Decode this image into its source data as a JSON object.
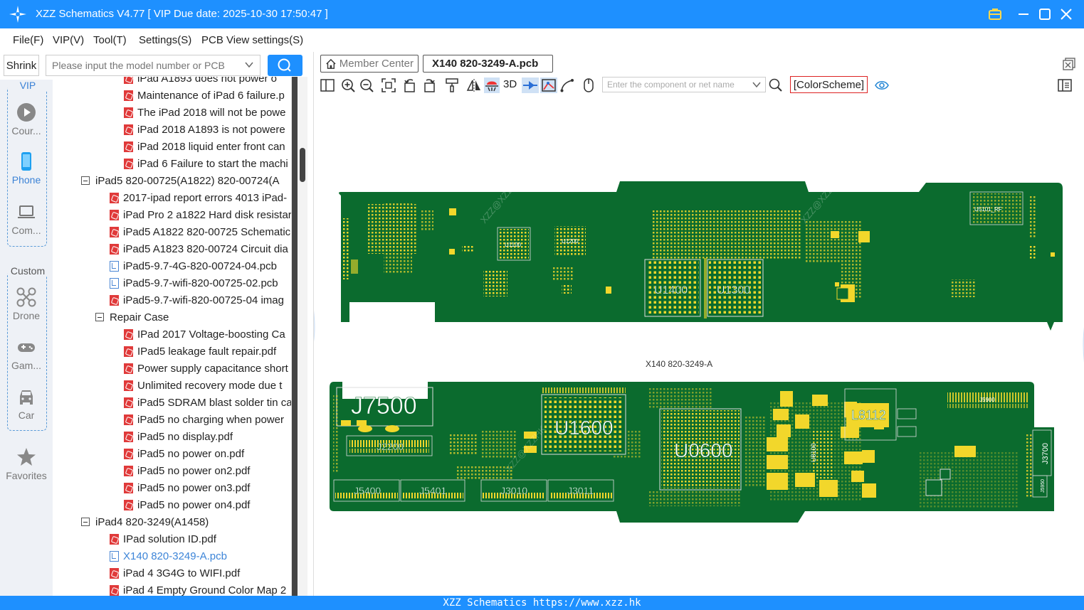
{
  "window": {
    "title": "XZZ Schematics V4.77 [ VIP Due date: 2025-10-30 17:50:47 ]"
  },
  "menu": [
    "File(F)",
    "VIP(V)",
    "Tool(T)",
    "Settings(S)",
    "PCB View settings(S)"
  ],
  "left_toolbar": {
    "shrink_label": "Shrink",
    "search_placeholder": "Please input the model number or PCB"
  },
  "rail": {
    "vip_group_label": "VIP",
    "custom_group_label": "Custom",
    "items": [
      {
        "label": "Cour...",
        "icon": "play-icon"
      },
      {
        "label": "Phone",
        "icon": "phone-icon"
      },
      {
        "label": "Com...",
        "icon": "laptop-icon"
      },
      {
        "label": "Drone",
        "icon": "drone-icon"
      },
      {
        "label": "Gam...",
        "icon": "gamepad-icon"
      },
      {
        "label": "Car",
        "icon": "car-icon"
      },
      {
        "label": "Favorites",
        "icon": "star-icon"
      }
    ]
  },
  "tree": [
    {
      "type": "pdf",
      "indent": 2,
      "label": "iPad A1893 does not power o"
    },
    {
      "type": "pdf",
      "indent": 2,
      "label": "Maintenance of iPad 6 failure.p"
    },
    {
      "type": "pdf",
      "indent": 2,
      "label": "The iPad 2018 will not be powe"
    },
    {
      "type": "pdf",
      "indent": 2,
      "label": "iPad 2018 A1893 is not powere"
    },
    {
      "type": "pdf",
      "indent": 2,
      "label": "iPad 2018 liquid enter front can"
    },
    {
      "type": "pdf",
      "indent": 2,
      "label": "iPad 6 Failure to start the machi"
    },
    {
      "type": "folder",
      "indent": 0,
      "label": "iPad5 820-00725(A1822) 820-00724(A"
    },
    {
      "type": "pdf",
      "indent": 1,
      "label": "2017-ipad report errors 4013 iPad-"
    },
    {
      "type": "pdf",
      "indent": 1,
      "label": "iPad Pro 2 a1822 Hard disk resistar"
    },
    {
      "type": "pdf",
      "indent": 1,
      "label": "iPad5 A1822 820-00725 Schematic"
    },
    {
      "type": "pdf",
      "indent": 1,
      "label": "iPad5 A1823 820-00724 Circuit dia"
    },
    {
      "type": "pcb",
      "indent": 1,
      "label": "iPad5-9.7-4G-820-00724-04.pcb"
    },
    {
      "type": "pcb",
      "indent": 1,
      "label": "iPad5-9.7-wifi-820-00725-02.pcb"
    },
    {
      "type": "pdf",
      "indent": 1,
      "label": "iPad5-9.7-wifi-820-00725-04 imag"
    },
    {
      "type": "folder",
      "indent": 1,
      "label": "Repair Case"
    },
    {
      "type": "pdf",
      "indent": 2,
      "label": "IPad 2017 Voltage-boosting Ca"
    },
    {
      "type": "pdf",
      "indent": 2,
      "label": "IPad5 leakage fault repair.pdf"
    },
    {
      "type": "pdf",
      "indent": 2,
      "label": "Power supply capacitance short"
    },
    {
      "type": "pdf",
      "indent": 2,
      "label": "Unlimited recovery mode due t"
    },
    {
      "type": "pdf",
      "indent": 2,
      "label": "iPad5 SDRAM blast solder tin ca"
    },
    {
      "type": "pdf",
      "indent": 2,
      "label": "iPad5 no charging when power"
    },
    {
      "type": "pdf",
      "indent": 2,
      "label": "iPad5 no display.pdf"
    },
    {
      "type": "pdf",
      "indent": 2,
      "label": "iPad5 no power on.pdf"
    },
    {
      "type": "pdf",
      "indent": 2,
      "label": "iPad5 no power on2.pdf"
    },
    {
      "type": "pdf",
      "indent": 2,
      "label": "iPad5 no power on3.pdf"
    },
    {
      "type": "pdf",
      "indent": 2,
      "label": "iPad5 no power on4.pdf"
    },
    {
      "type": "folder",
      "indent": 0,
      "label": "iPad4 820-3249(A1458)"
    },
    {
      "type": "pdf",
      "indent": 1,
      "label": "IPad solution ID.pdf"
    },
    {
      "type": "pcb",
      "indent": 1,
      "label": "X140 820-3249-A.pcb",
      "selected": true
    },
    {
      "type": "pdf",
      "indent": 1,
      "label": "iPad 4 3G4G to WIFI.pdf"
    },
    {
      "type": "pdf",
      "indent": 1,
      "label": "iPad 4 Empty Ground Color Map 2"
    }
  ],
  "tabs": {
    "member": "Member Center",
    "pcb": "X140 820-3249-A.pcb"
  },
  "pcb_toolbar": {
    "label_3d": "3D",
    "component_placeholder": "Enter the component or net name",
    "color_scheme": "[ColorScheme]"
  },
  "pcb": {
    "caption": "X140 820-3249-A",
    "board_color": "#0b6b2e",
    "pad_color": "#f2d72b",
    "top_labels": [
      "U1400",
      "U1300",
      "U1100",
      "U1200",
      "U5101_RF"
    ],
    "bottom_labels": [
      "J7500",
      "J2200",
      "U1600",
      "U0600",
      "L8112",
      "J5400",
      "J5401",
      "J3010",
      "J3011",
      "J3700",
      "J5900",
      "U8100",
      "J5950"
    ],
    "watermark": "XZZ@XZZHK"
  },
  "status": {
    "text": "XZZ Schematics https://www.xzz.hk"
  },
  "colors": {
    "accent": "#1e90ff",
    "selected_text": "#3d85d8",
    "pdf_icon": "#e03a3a"
  }
}
